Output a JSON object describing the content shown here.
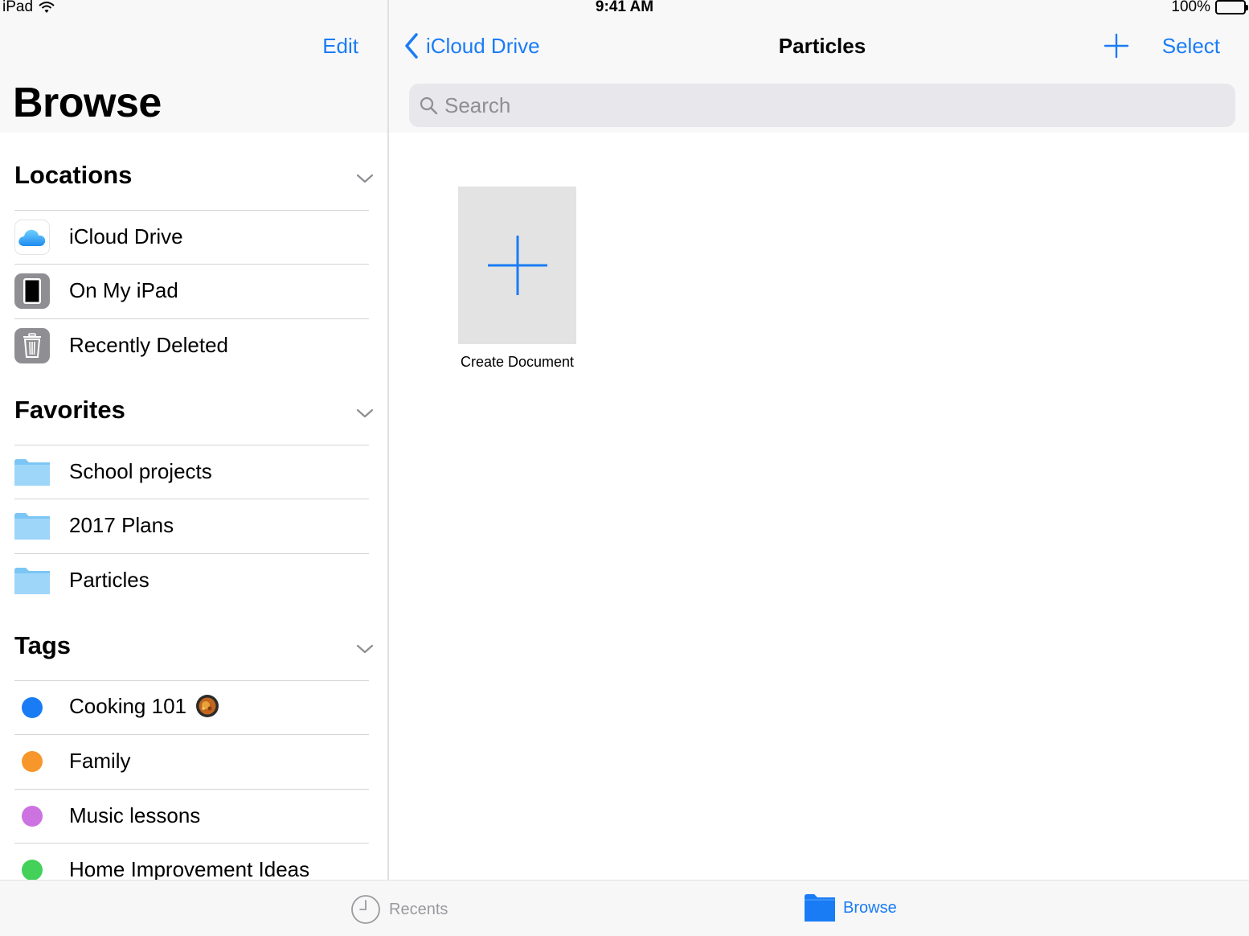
{
  "status_bar": {
    "device": "iPad",
    "time": "9:41 AM",
    "battery": "100%"
  },
  "sidebar": {
    "edit_label": "Edit",
    "title": "Browse",
    "sections": {
      "locations": {
        "title": "Locations",
        "items": [
          {
            "label": "iCloud Drive",
            "icon": "icloud-icon"
          },
          {
            "label": "On My iPad",
            "icon": "ipad-icon"
          },
          {
            "label": "Recently Deleted",
            "icon": "trash-icon"
          }
        ]
      },
      "favorites": {
        "title": "Favorites",
        "items": [
          {
            "label": "School projects",
            "icon": "folder-icon"
          },
          {
            "label": "2017 Plans",
            "icon": "folder-icon"
          },
          {
            "label": "Particles",
            "icon": "folder-icon"
          }
        ]
      },
      "tags": {
        "title": "Tags",
        "items": [
          {
            "label": "Cooking 101",
            "color": "#1a7cf5"
          },
          {
            "label": "Family",
            "color": "#f7962a"
          },
          {
            "label": "Music lessons",
            "color": "#cc73e1"
          },
          {
            "label": "Home Improvement Ideas",
            "color": "#43d159"
          }
        ]
      }
    }
  },
  "main": {
    "back_label": "iCloud Drive",
    "title": "Particles",
    "select_label": "Select",
    "search": {
      "placeholder": "Search",
      "value": ""
    },
    "create_document_label": "Create Document"
  },
  "tab_bar": {
    "tabs": [
      {
        "label": "Recents",
        "icon": "clock-icon",
        "active": false
      },
      {
        "label": "Browse",
        "icon": "folder-icon",
        "active": true
      }
    ]
  },
  "colors": {
    "accent": "#1a7cf5",
    "folder": "#7cc6f5",
    "secondary_text": "#8e8e93"
  }
}
